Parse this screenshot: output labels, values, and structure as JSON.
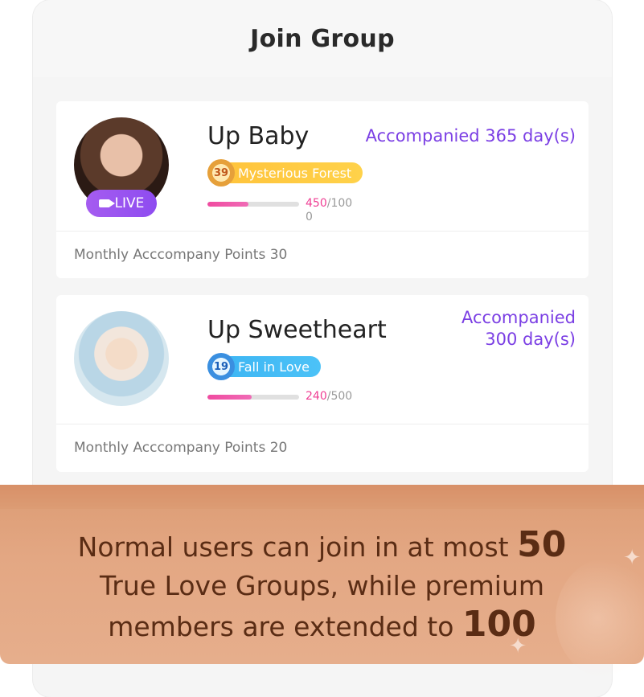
{
  "header": {
    "title": "Join Group"
  },
  "cards": [
    {
      "name": "Up Baby",
      "accompanied": "Accompanied 365 day(s)",
      "live_label": "LIVE",
      "badge_level": "39",
      "badge_text": "Mysterious Forest",
      "points_current": "450",
      "points_total": "/100\n0",
      "progress": 0.45,
      "monthly": "Monthly Acccompany Points 30"
    },
    {
      "name": "Up Sweetheart",
      "accompanied": "Accompanied\n300 day(s)",
      "badge_level": "19",
      "badge_text": "Fall in Love",
      "points_current": "240",
      "points_total": "/500",
      "progress": 0.48,
      "monthly": "Monthly Acccompany Points 20"
    }
  ],
  "banner": {
    "line1": "Normal users can join in at most ",
    "num1": "50",
    "line2": "True Love Groups, while premium",
    "line3": "members are extended to ",
    "num2": "100"
  },
  "colors": {
    "accent": "#7b3fe4",
    "pink": "#ef3f94",
    "banner": "#e3a783"
  }
}
